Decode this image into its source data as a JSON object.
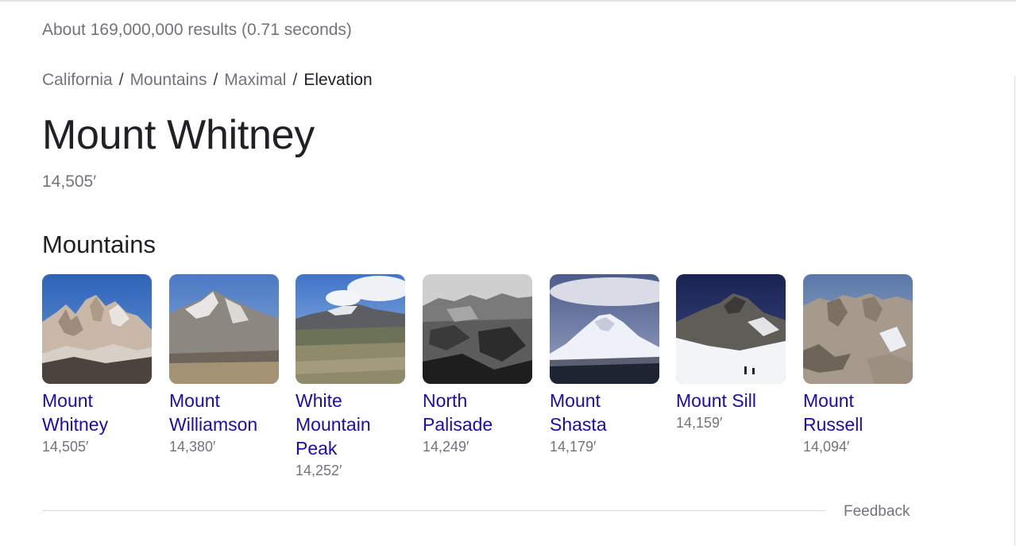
{
  "result_stats": "About 169,000,000 results (0.71 seconds)",
  "breadcrumb": {
    "items": [
      "California",
      "Mountains",
      "Maximal"
    ],
    "current": "Elevation",
    "separator": "/"
  },
  "answer": {
    "title": "Mount Whitney",
    "elevation": "14,505′"
  },
  "section": {
    "title": "Mountains",
    "items": [
      {
        "name": "Mount Whitney",
        "elevation": "14,505′",
        "image": "mount-whitney-photo"
      },
      {
        "name": "Mount Williamson",
        "elevation": "14,380′",
        "image": "mount-williamson-photo"
      },
      {
        "name": "White Mountain Peak",
        "elevation": "14,252′",
        "image": "white-mountain-peak-photo"
      },
      {
        "name": "North Palisade",
        "elevation": "14,249′",
        "image": "north-palisade-photo"
      },
      {
        "name": "Mount Shasta",
        "elevation": "14,179′",
        "image": "mount-shasta-photo"
      },
      {
        "name": "Mount Sill",
        "elevation": "14,159′",
        "image": "mount-sill-photo"
      },
      {
        "name": "Mount Russell",
        "elevation": "14,094′",
        "image": "mount-russell-photo"
      }
    ]
  },
  "footer": {
    "feedback": "Feedback"
  },
  "colors": {
    "link": "#1a0dab",
    "secondary_text": "#70757a",
    "primary_text": "#202124"
  }
}
